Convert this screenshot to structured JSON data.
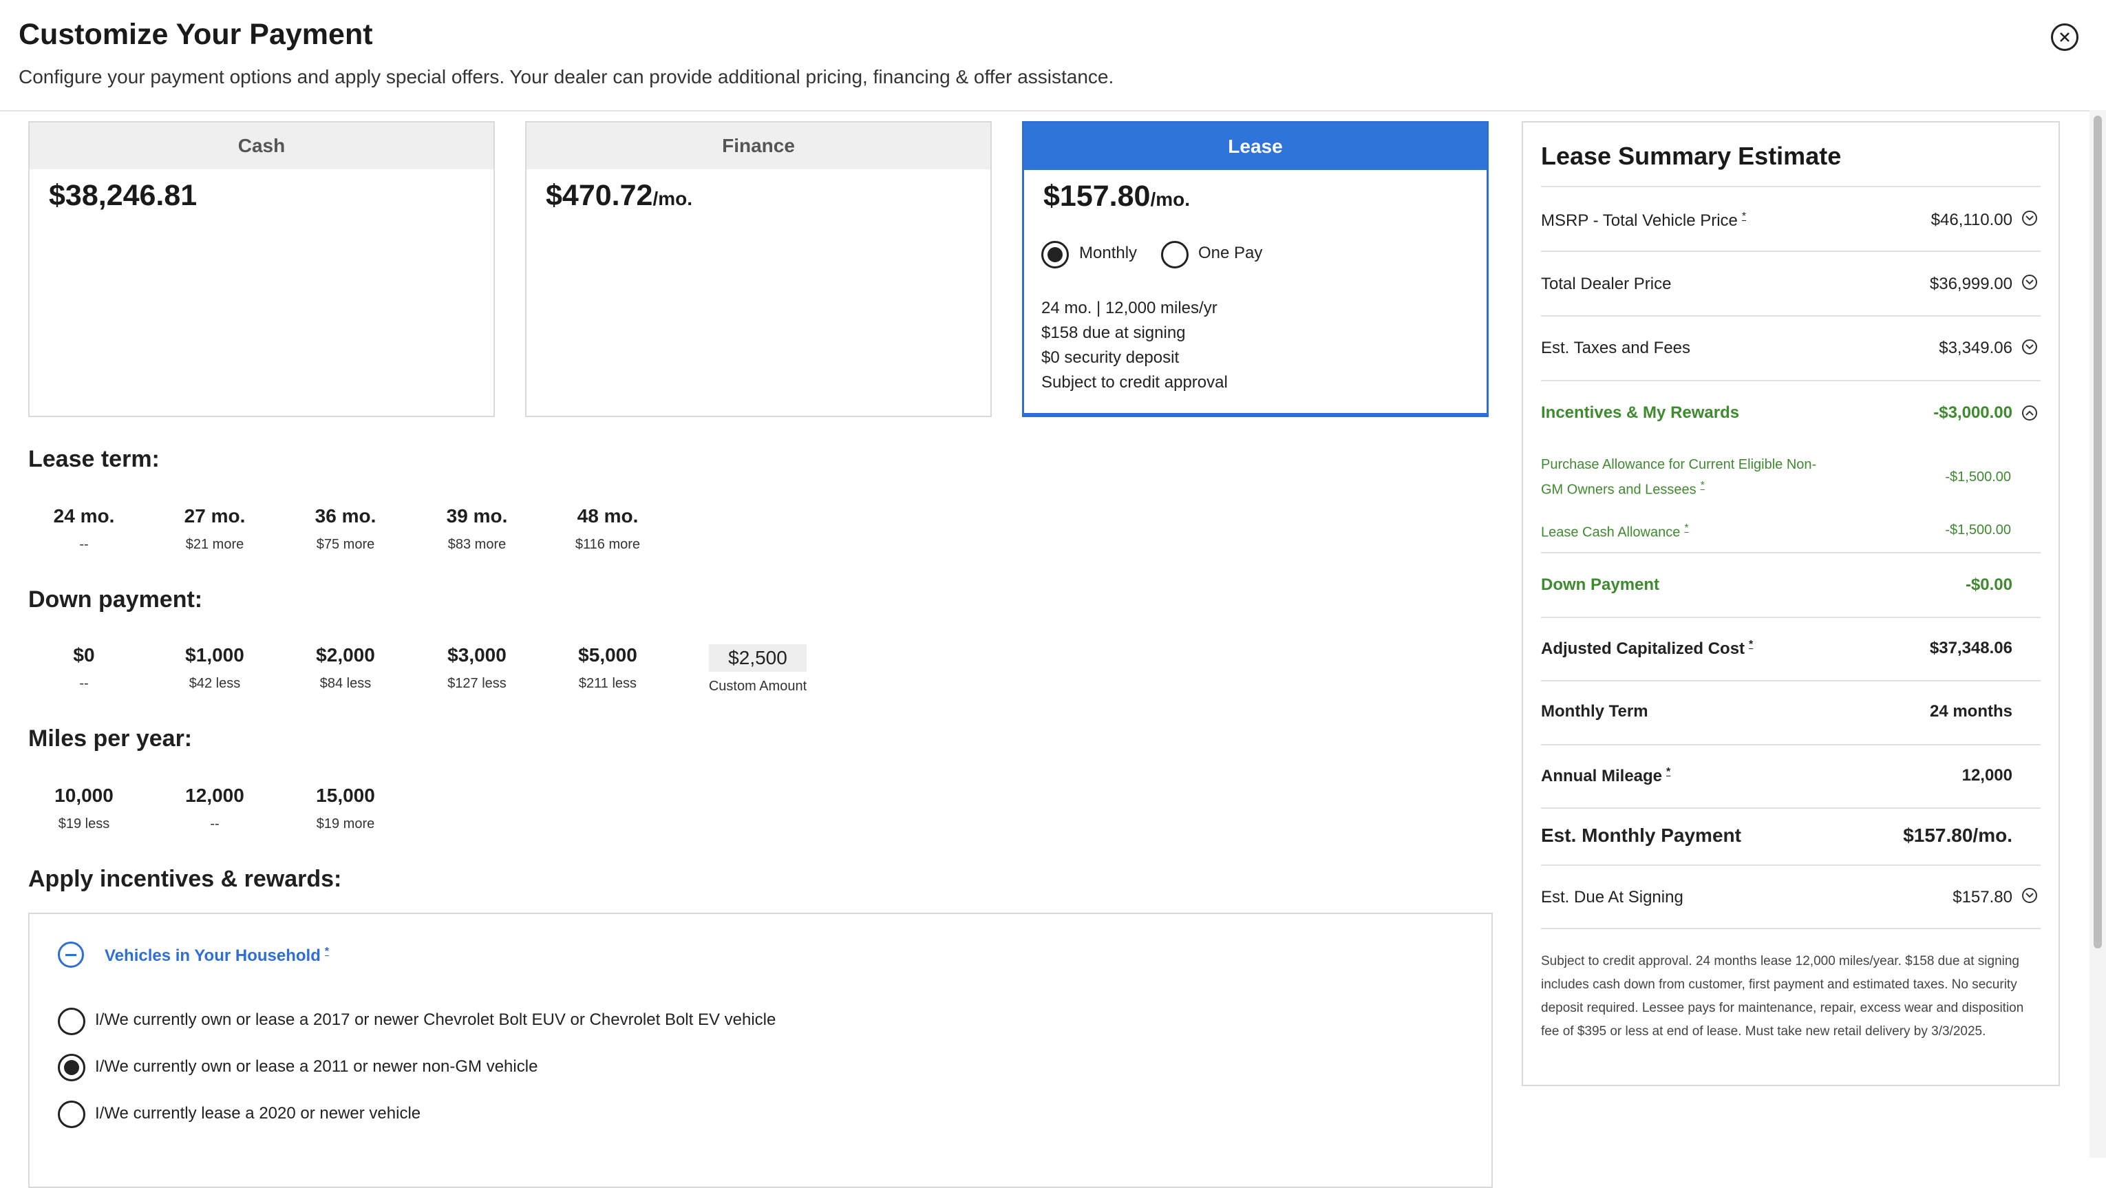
{
  "header": {
    "title": "Customize Your Payment",
    "subtitle": "Configure your payment options and apply special offers. Your dealer can provide additional pricing, financing & offer assistance."
  },
  "cards": {
    "cash": {
      "label": "Cash",
      "price": "$38,246.81"
    },
    "finance": {
      "label": "Finance",
      "price": "$470.72",
      "per": "/mo."
    },
    "lease": {
      "label": "Lease",
      "price": "$157.80",
      "per": "/mo.",
      "monthly_label": "Monthly",
      "onepay_label": "One Pay",
      "selected": "Monthly",
      "details": [
        "24 mo. | 12,000 miles/yr",
        "$158 due at signing",
        "$0 security deposit",
        "Subject to credit approval"
      ]
    }
  },
  "lease_term": {
    "title": "Lease term:",
    "options": [
      {
        "value": "24 mo.",
        "sub": "--"
      },
      {
        "value": "27 mo.",
        "sub": "$21 more"
      },
      {
        "value": "36 mo.",
        "sub": "$75 more"
      },
      {
        "value": "39 mo.",
        "sub": "$83 more"
      },
      {
        "value": "48 mo.",
        "sub": "$116 more"
      }
    ]
  },
  "down_payment": {
    "title": "Down payment:",
    "options": [
      {
        "value": "$0",
        "sub": "--"
      },
      {
        "value": "$1,000",
        "sub": "$42 less"
      },
      {
        "value": "$2,000",
        "sub": "$84 less"
      },
      {
        "value": "$3,000",
        "sub": "$127 less"
      },
      {
        "value": "$5,000",
        "sub": "$211 less"
      }
    ],
    "custom_value": "$2,500",
    "custom_label": "Custom Amount"
  },
  "miles": {
    "title": "Miles per year:",
    "options": [
      {
        "value": "10,000",
        "sub": "$19 less"
      },
      {
        "value": "12,000",
        "sub": "--"
      },
      {
        "value": "15,000",
        "sub": "$19 more"
      }
    ]
  },
  "incentives": {
    "title": "Apply incentives & rewards:",
    "household_label": "Vehicles in Your Household",
    "asterisk": "*",
    "options": [
      {
        "label": "I/We currently own or lease a 2017 or newer Chevrolet Bolt EUV or Chevrolet Bolt EV vehicle",
        "selected": false
      },
      {
        "label": "I/We currently own or lease a 2011 or newer non-GM vehicle",
        "selected": true
      },
      {
        "label": "I/We currently lease a 2020 or newer vehicle",
        "selected": false
      }
    ]
  },
  "summary": {
    "title": "Lease Summary Estimate",
    "msrp_label": "MSRP - Total Vehicle Price",
    "msrp_value": "$46,110.00",
    "dealer_label": "Total Dealer Price",
    "dealer_value": "$36,999.00",
    "taxes_label": "Est. Taxes and Fees",
    "taxes_value": "$3,349.06",
    "incentives_label": "Incentives & My Rewards",
    "incentives_value": "-$3,000.00",
    "purchase_allow_label_1": "Purchase Allowance for Current Eligible Non-",
    "purchase_allow_label_2": "GM Owners and Lessees",
    "purchase_allow_value": "-$1,500.00",
    "lease_cash_label": "Lease Cash Allowance",
    "lease_cash_value": "-$1,500.00",
    "down_label": "Down Payment",
    "down_value": "-$0.00",
    "acc_label": "Adjusted Capitalized Cost",
    "acc_value": "$37,348.06",
    "term_label": "Monthly Term",
    "term_value": "24 months",
    "mileage_label": "Annual Mileage",
    "mileage_value": "12,000",
    "monthly_label": "Est. Monthly Payment",
    "monthly_value": "$157.80/mo.",
    "due_label": "Est. Due At Signing",
    "due_value": "$157.80",
    "disclaimer": "Subject to credit approval. 24 months lease 12,000 miles/year. $158 due at signing includes cash down from customer, first payment and estimated taxes. No security deposit required. Lessee pays for maintenance, repair, excess wear and disposition fee of $395 or less at end of lease. Must take new retail delivery by 3/3/2025."
  },
  "colors": {
    "accent": "#2f74d8",
    "green": "#3e8a2e",
    "border": "#d9d9d9"
  },
  "icons": [
    "close-icon",
    "minus-circle-icon",
    "chevron-down-icon",
    "chevron-up-icon",
    "radio-icon"
  ]
}
